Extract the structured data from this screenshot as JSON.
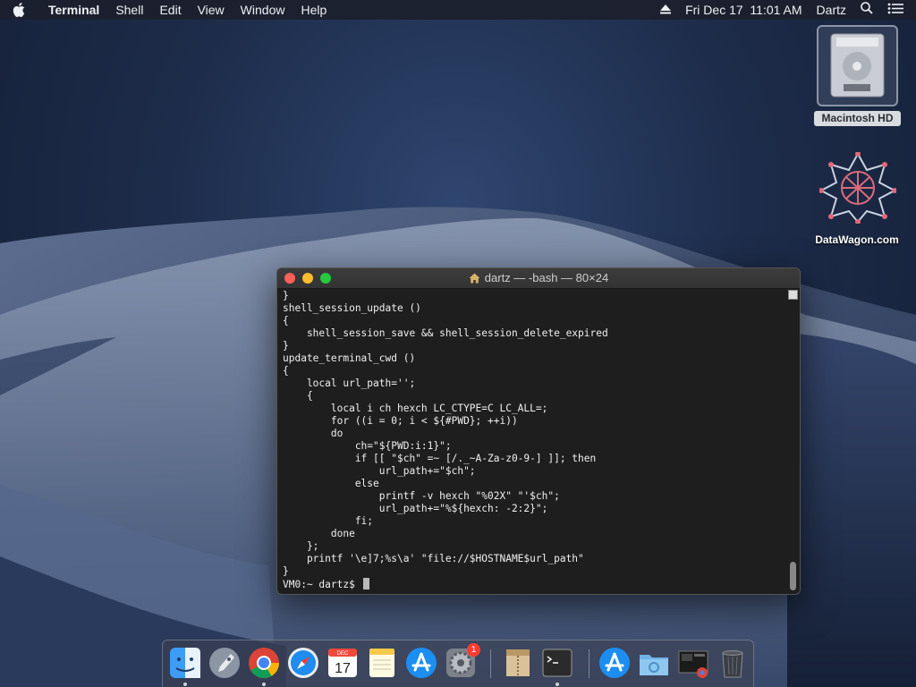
{
  "menubar": {
    "app_name": "Terminal",
    "items": [
      "Shell",
      "Edit",
      "View",
      "Window",
      "Help"
    ],
    "datetime": "Fri Dec 17  11:01 AM",
    "user": "Dartz"
  },
  "desktop": {
    "icons": [
      {
        "label": "Macintosh HD",
        "icon": "hard-drive-icon"
      },
      {
        "label": "DataWagon.com",
        "icon": "datawagon-icon"
      }
    ]
  },
  "terminal": {
    "title": "dartz — -bash — 80×24",
    "lines": [
      "}",
      "shell_session_update ()",
      "{",
      "    shell_session_save && shell_session_delete_expired",
      "}",
      "update_terminal_cwd ()",
      "{",
      "    local url_path='';",
      "    {",
      "        local i ch hexch LC_CTYPE=C LC_ALL=;",
      "        for ((i = 0; i < ${#PWD}; ++i))",
      "        do",
      "            ch=\"${PWD:i:1}\";",
      "            if [[ \"$ch\" =~ [/._~A-Za-z0-9-] ]]; then",
      "                url_path+=\"$ch\";",
      "            else",
      "                printf -v hexch \"%02X\" \"'$ch\";",
      "                url_path+=\"%${hexch: -2:2}\";",
      "            fi;",
      "        done",
      "    };",
      "    printf '\\e]7;%s\\a' \"file://$HOSTNAME$url_path\"",
      "}"
    ],
    "prompt": "VM0:~ dartz$ "
  },
  "dock": {
    "apps": [
      "Finder",
      "Launchpad",
      "Chrome",
      "Safari",
      "Calendar",
      "Notes",
      "App Store",
      "System Preferences",
      "Archive Utility",
      "Terminal",
      "App Store Downloads",
      "Folder",
      "Screenshot",
      "Trash"
    ],
    "calendar_month": "DEC",
    "calendar_day": "17",
    "sysprefs_badge": "1"
  }
}
